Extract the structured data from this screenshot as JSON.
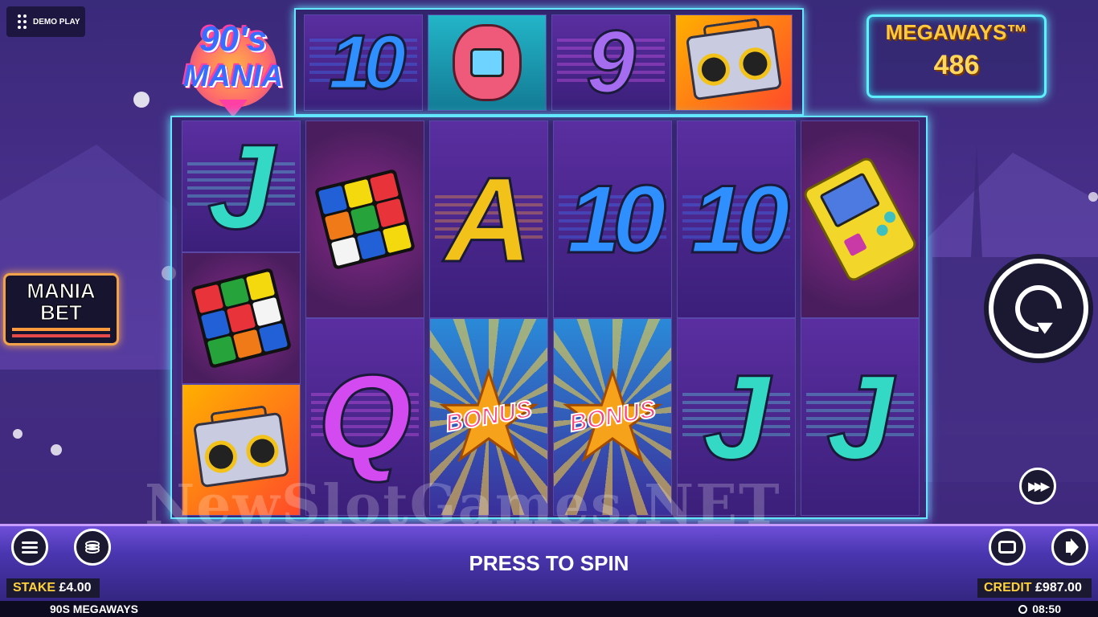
{
  "demo_tag": {
    "label": "DEMO PLAY"
  },
  "logo": {
    "line1": "90's",
    "line2": "MANIA"
  },
  "megaways": {
    "title": "MEGAWAYS™",
    "count": "486"
  },
  "top_reel": [
    {
      "symbol": "10",
      "kind": "ten"
    },
    {
      "symbol": "tamagotchi",
      "kind": "tamagotchi"
    },
    {
      "symbol": "9",
      "kind": "nine"
    },
    {
      "symbol": "boombox",
      "kind": "boombox"
    }
  ],
  "reels": [
    [
      "J",
      "rubiks-cube",
      "boombox"
    ],
    [
      "rubiks-cube",
      "Q"
    ],
    [
      "A",
      "BONUS"
    ],
    [
      "10",
      "BONUS"
    ],
    [
      "10",
      "J"
    ],
    [
      "gameboy",
      "J"
    ]
  ],
  "bonus": {
    "label": "BONUS"
  },
  "mania_bet": {
    "line1": "MANIA",
    "line2": "BET"
  },
  "watermark": "NewSlotGames.NET",
  "press_to_spin": "PRESS TO SPIN",
  "stake": {
    "label": "STAKE",
    "value": "£4.00"
  },
  "credit": {
    "label": "CREDIT",
    "value": "£987.00"
  },
  "status": {
    "game_name": "90S MEGAWAYS",
    "time": "08:50"
  },
  "colors": {
    "frame": "#64e6ff",
    "accent_gold": "#ffd23c",
    "mania_border": "#f2a24a"
  }
}
